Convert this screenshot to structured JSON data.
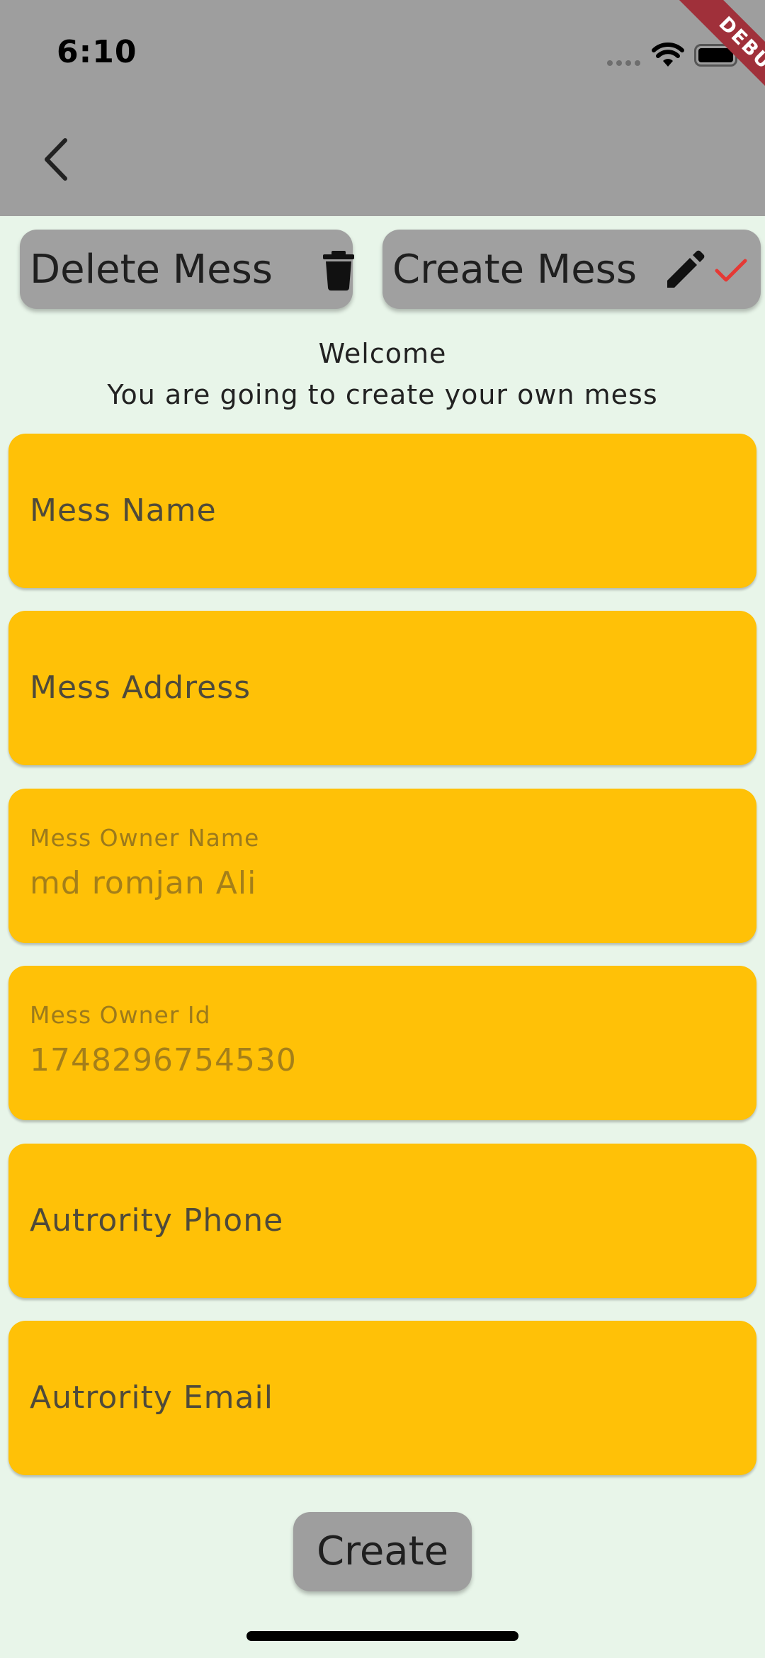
{
  "status_bar": {
    "time": "6:10"
  },
  "debug_banner": "DEBUG",
  "toolbar": {
    "delete_label": "Delete Mess",
    "create_mess_label": "Create Mess"
  },
  "welcome": {
    "line1": "Welcome",
    "line2": "You are going to create your own mess"
  },
  "form": {
    "fields": [
      {
        "label": "Mess Name",
        "value": ""
      },
      {
        "label": "Mess Address",
        "value": ""
      },
      {
        "label": "Mess Owner Name",
        "value": "md romjan Ali"
      },
      {
        "label": "Mess Owner Id",
        "value": "1748296754530"
      },
      {
        "label": "Autrority Phone",
        "value": ""
      },
      {
        "label": "Autrority Email",
        "value": ""
      }
    ],
    "submit_label": "Create"
  },
  "colors": {
    "background": "#E8F5E9",
    "app_bar": "#9E9E9E",
    "field_fill": "#FFC107",
    "button_fill": "#A0A0A0",
    "check_accent": "#E53935",
    "debug_banner": "#A0303A"
  },
  "icons": {
    "back": "chevron-left-icon",
    "delete": "trash-icon",
    "edit": "pencil-icon",
    "confirm": "check-icon",
    "wifi": "wifi-icon",
    "battery": "battery-icon",
    "signal": "signal-dots-icon"
  }
}
